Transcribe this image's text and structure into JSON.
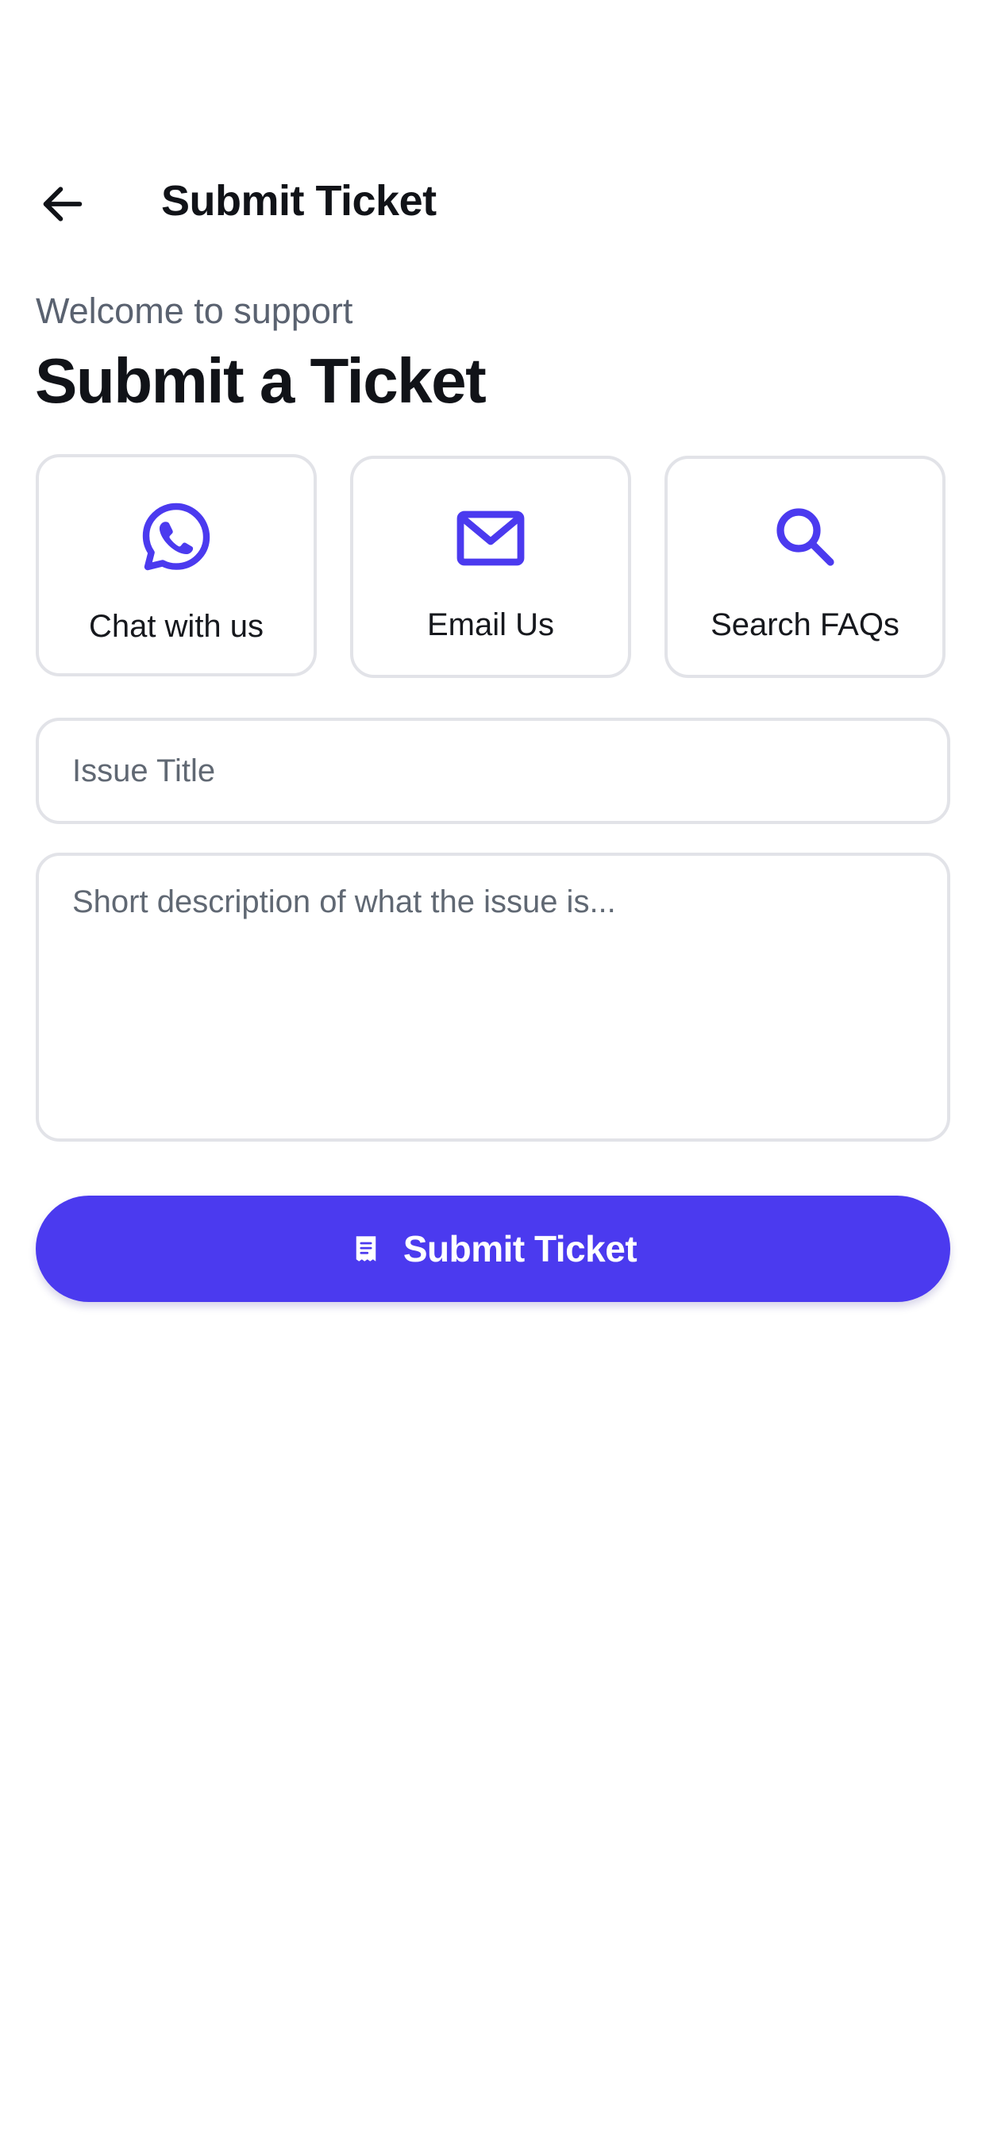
{
  "header": {
    "title": "Submit Ticket",
    "back_icon": "arrow-left-icon"
  },
  "intro": {
    "welcome": "Welcome to support",
    "title": "Submit a Ticket"
  },
  "options": [
    {
      "label": "Chat with us",
      "icon": "whatsapp-icon"
    },
    {
      "label": "Email Us",
      "icon": "mail-icon"
    },
    {
      "label": "Search FAQs",
      "icon": "search-icon"
    }
  ],
  "form": {
    "title_placeholder": "Issue Title",
    "title_value": "",
    "description_placeholder": "Short description of what the issue is...",
    "description_value": ""
  },
  "submit": {
    "label": "Submit Ticket",
    "icon": "receipt-icon"
  },
  "colors": {
    "accent": "#4b3aef",
    "border": "#e2e3e8",
    "muted_text": "#5a6270",
    "text": "#111318"
  }
}
